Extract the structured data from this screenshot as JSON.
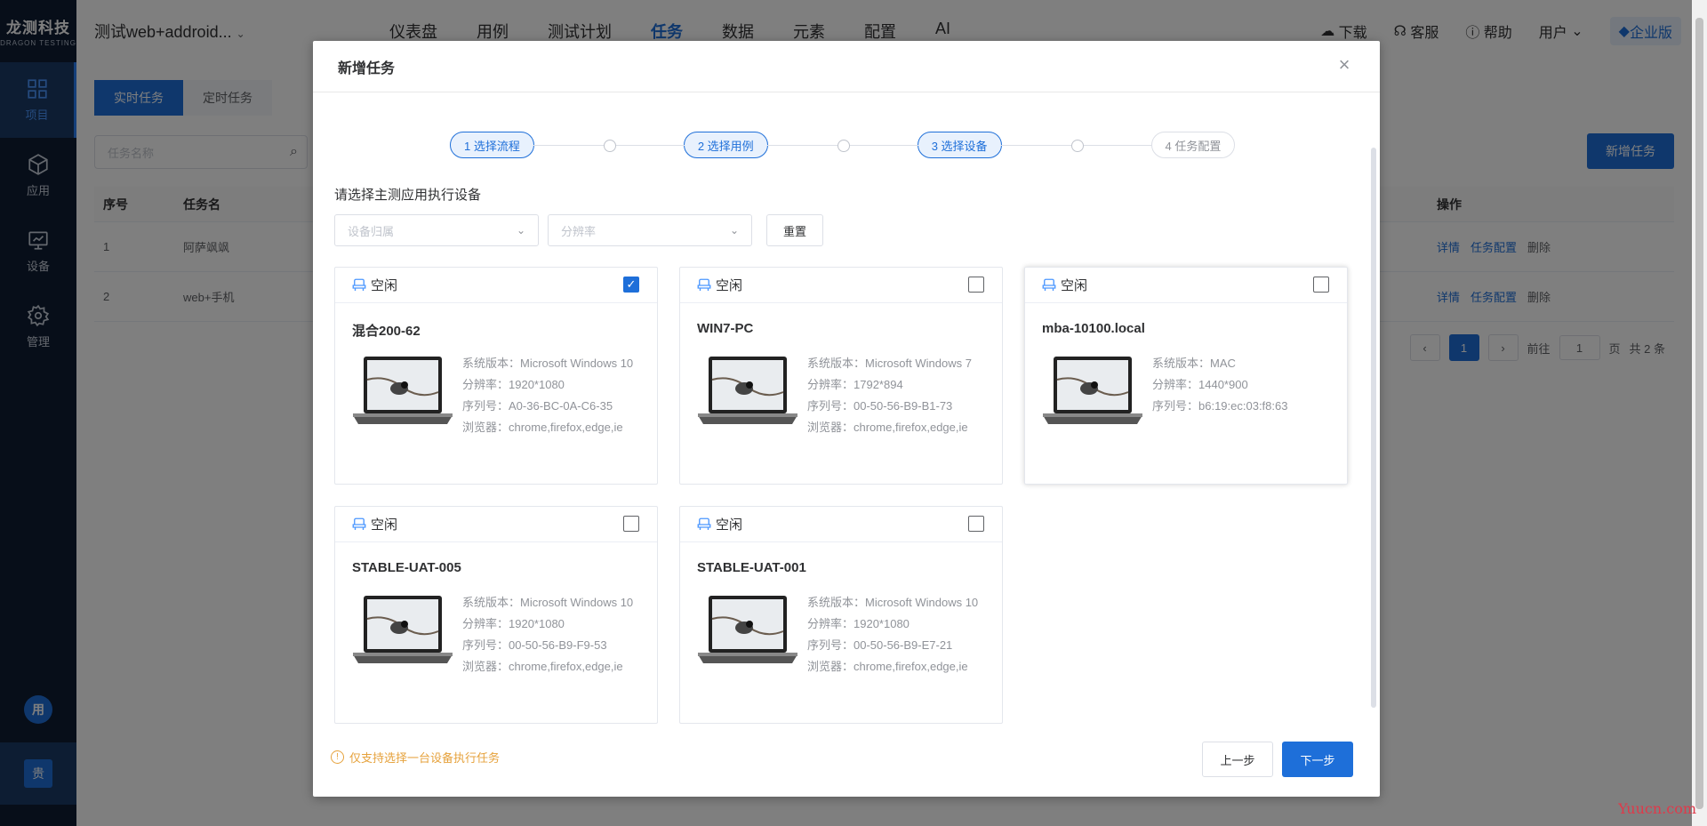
{
  "brand": {
    "name": "龙测科技",
    "sub": "DRAGON TESTING"
  },
  "sidebar": {
    "items": [
      {
        "label": "项目",
        "icon": "grid-icon"
      },
      {
        "label": "应用",
        "icon": "cube-icon"
      },
      {
        "label": "设备",
        "icon": "monitor-icon"
      },
      {
        "label": "管理",
        "icon": "gear-icon"
      }
    ],
    "avatar1": "用",
    "avatar2": "贵"
  },
  "header": {
    "project": "测试web+addroid...",
    "nav": [
      "仪表盘",
      "用例",
      "测试计划",
      "任务",
      "数据",
      "元素",
      "配置",
      "AI"
    ],
    "active_nav": "任务",
    "download": "下载",
    "service": "客服",
    "help": "帮助",
    "user": "用户",
    "edition": "企业版"
  },
  "page": {
    "tabs": [
      "实时任务",
      "定时任务"
    ],
    "search_placeholder": "任务名称",
    "new_task": "新增任务",
    "columns": {
      "no": "序号",
      "name": "任务名",
      "ops": "操作"
    },
    "rows": [
      {
        "no": "1",
        "name": "阿萨飒飒"
      },
      {
        "no": "2",
        "name": "web+手机"
      }
    ],
    "ops": [
      "详情",
      "任务配置",
      "删除"
    ],
    "pagination": {
      "current": "1",
      "goto": "前往",
      "page_input": "1",
      "page_unit": "页",
      "total": "共 2 条"
    }
  },
  "modal": {
    "title": "新增任务",
    "steps": [
      "1 选择流程",
      "2 选择用例",
      "3 选择设备",
      "4 任务配置"
    ],
    "hint": "请选择主测应用执行设备",
    "filter_owner_placeholder": "设备归属",
    "filter_resolution_placeholder": "分辨率",
    "reset": "重置",
    "devices": [
      {
        "status": "空闲",
        "checked": true,
        "name": "混合200-62",
        "os": "系统版本：Microsoft Windows 10",
        "res": "分辨率：1920*1080",
        "serial": "序列号：A0-36-BC-0A-C6-35",
        "browser": "浏览器：chrome,firefox,edge,ie"
      },
      {
        "status": "空闲",
        "checked": false,
        "name": "WIN7-PC",
        "os": "系统版本：Microsoft Windows 7",
        "res": "分辨率：1792*894",
        "serial": "序列号：00-50-56-B9-B1-73",
        "browser": "浏览器：chrome,firefox,edge,ie"
      },
      {
        "status": "空闲",
        "checked": false,
        "name": "mba-10100.local",
        "os": "系统版本：MAC",
        "res": "分辨率：1440*900",
        "serial": "序列号：b6:19:ec:03:f8:63",
        "browser": ""
      },
      {
        "status": "空闲",
        "checked": false,
        "name": "STABLE-UAT-005",
        "os": "系统版本：Microsoft Windows 10",
        "res": "分辨率：1920*1080",
        "serial": "序列号：00-50-56-B9-F9-53",
        "browser": "浏览器：chrome,firefox,edge,ie"
      },
      {
        "status": "空闲",
        "checked": false,
        "name": "STABLE-UAT-001",
        "os": "系统版本：Microsoft Windows 10",
        "res": "分辨率：1920*1080",
        "serial": "序列号：00-50-56-B9-E7-21",
        "browser": "浏览器：chrome,firefox,edge,ie"
      }
    ],
    "warning": "仅支持选择一台设备执行任务",
    "prev": "上一步",
    "next": "下一步"
  },
  "watermark": "Yuucn.com",
  "colors": {
    "primary": "#1e6fd9",
    "sidebar": "#0f1d33",
    "warning": "#e6a23c"
  }
}
